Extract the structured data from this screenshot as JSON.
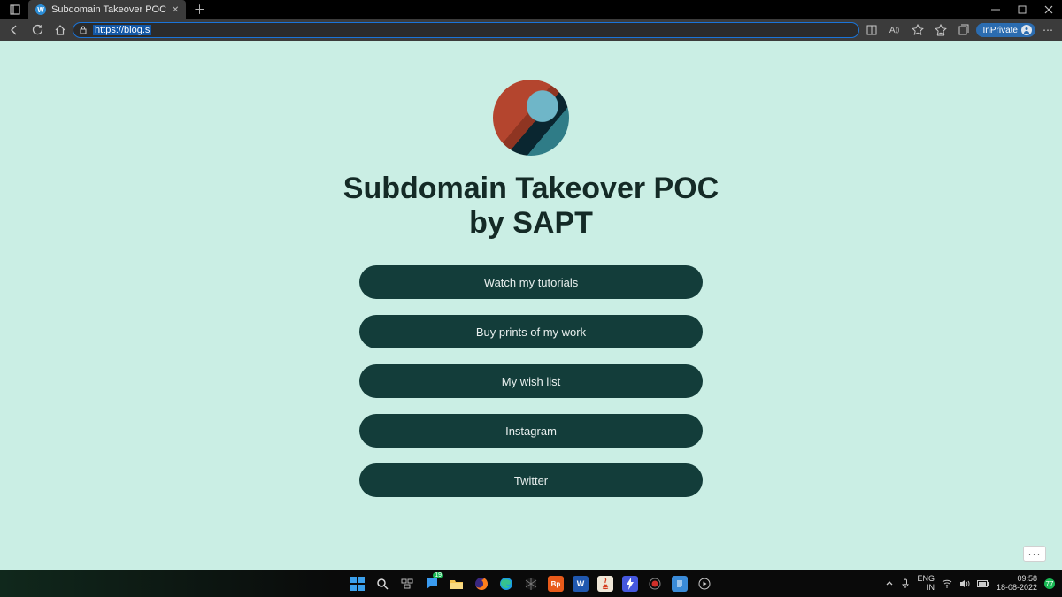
{
  "browser": {
    "tab_title": "Subdomain Takeover POC",
    "url_highlighted": "https://blog.s",
    "inprivate_label": "InPrivate"
  },
  "page": {
    "heading_line1": "Subdomain Takeover POC",
    "heading_line2": "by SAPT",
    "links": [
      "Watch my tutorials",
      "Buy prints of my work",
      "My wish list",
      "Instagram",
      "Twitter"
    ],
    "more": "···"
  },
  "taskbar": {
    "lang_top": "ENG",
    "lang_bottom": "IN",
    "time": "09:58",
    "date": "18-08-2022",
    "badge": "77"
  }
}
